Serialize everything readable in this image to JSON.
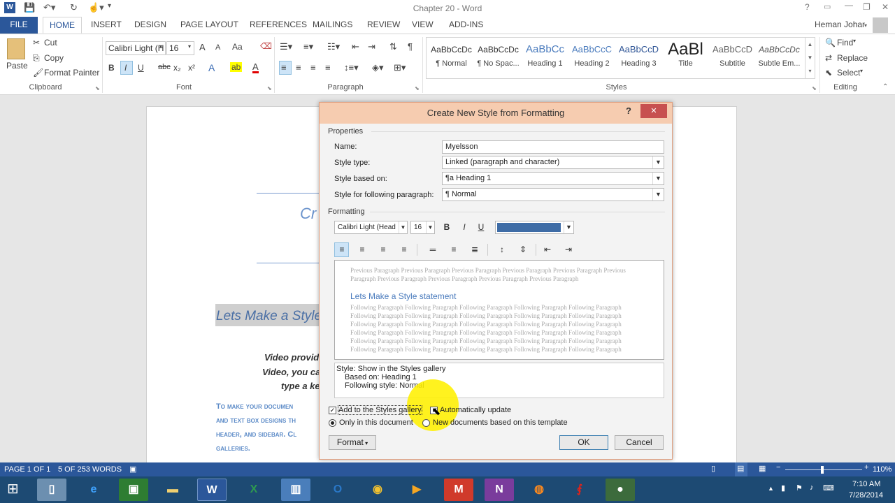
{
  "window": {
    "title": "Chapter 20 - Word",
    "user": "Heman Johar"
  },
  "tabs": [
    "FILE",
    "HOME",
    "INSERT",
    "DESIGN",
    "PAGE LAYOUT",
    "REFERENCES",
    "MAILINGS",
    "REVIEW",
    "VIEW",
    "ADD-INS"
  ],
  "ribbon": {
    "clipboard": {
      "paste": "Paste",
      "cut": "Cut",
      "copy": "Copy",
      "format_painter": "Format Painter",
      "label": "Clipboard"
    },
    "font": {
      "name": "Calibri Light (H",
      "size": "16",
      "label": "Font",
      "bold": "B",
      "italic": "I",
      "underline": "U",
      "strike": "abc",
      "sub": "x₂",
      "sup": "x²",
      "grow": "A",
      "shrink": "A",
      "case": "Aa"
    },
    "paragraph": {
      "label": "Paragraph"
    },
    "styles": {
      "label": "Styles",
      "items": [
        {
          "sample": "AaBbCcDc",
          "name": "¶ Normal"
        },
        {
          "sample": "AaBbCcDc",
          "name": "¶ No Spac..."
        },
        {
          "sample": "AaBbCc",
          "name": "Heading 1"
        },
        {
          "sample": "AaBbCcC",
          "name": "Heading 2"
        },
        {
          "sample": "AaBbCcD",
          "name": "Heading 3"
        },
        {
          "sample": "AaBl",
          "name": "Title"
        },
        {
          "sample": "AaBbCcD",
          "name": "Subtitle"
        },
        {
          "sample": "AaBbCcDc",
          "name": "Subtle Em..."
        }
      ]
    },
    "editing": {
      "find": "Find",
      "replace": "Replace",
      "select": "Select",
      "label": "Editing"
    }
  },
  "document": {
    "heading_fragment": "Cr",
    "selected_text": "Lets Make a Style",
    "body_lines": [
      "Video provid",
      "Video, you ca",
      "type a ke"
    ],
    "caps_lines": [
      "To make your documen",
      "and text box designs th",
      "header, and sidebar. Cl",
      "galleries."
    ]
  },
  "dialog": {
    "title": "Create New Style from Formatting",
    "help": "?",
    "close": "✕",
    "properties_label": "Properties",
    "name_label": "Name:",
    "name_value": "Myelsson",
    "type_label": "Style type:",
    "type_value": "Linked (paragraph and character)",
    "based_label": "Style based on:",
    "based_value": "¶a Heading 1",
    "following_label": "Style for following paragraph:",
    "following_value": "¶ Normal",
    "formatting_label": "Formatting",
    "font_value": "Calibri Light (Head",
    "size_value": "16",
    "bold": "B",
    "italic": "I",
    "underline": "U",
    "color": "#3e6ca6",
    "preview": {
      "previous": [
        "Previous Paragraph Previous Paragraph Previous Paragraph Previous Paragraph Previous Paragraph Previous",
        "Paragraph Previous Paragraph Previous Paragraph Previous Paragraph Previous Paragraph"
      ],
      "sample": "Lets Make a Style statement",
      "following": [
        "Following Paragraph Following Paragraph Following Paragraph Following Paragraph Following Paragraph",
        "Following Paragraph Following Paragraph Following Paragraph Following Paragraph Following Paragraph",
        "Following Paragraph Following Paragraph Following Paragraph Following Paragraph Following Paragraph",
        "Following Paragraph Following Paragraph Following Paragraph Following Paragraph Following Paragraph",
        "Following Paragraph Following Paragraph Following Paragraph Following Paragraph Following Paragraph",
        "Following Paragraph Following Paragraph Following Paragraph Following Paragraph Following Paragraph"
      ]
    },
    "description": [
      "Style: Show in the Styles gallery",
      "Based on: Heading 1",
      "Following style: Normal"
    ],
    "add_gallery": "Add to the Styles gallery",
    "auto_update": "Automatically update",
    "only_doc": "Only in this document",
    "new_docs": "New documents based on this template",
    "format_btn": "Format",
    "ok": "OK",
    "cancel": "Cancel"
  },
  "statusbar": {
    "page": "PAGE 1 OF 1",
    "words": "5 OF 253 WORDS",
    "zoom": "110%"
  },
  "taskbar": {
    "time": "7:10 AM",
    "date": "7/28/2014"
  }
}
